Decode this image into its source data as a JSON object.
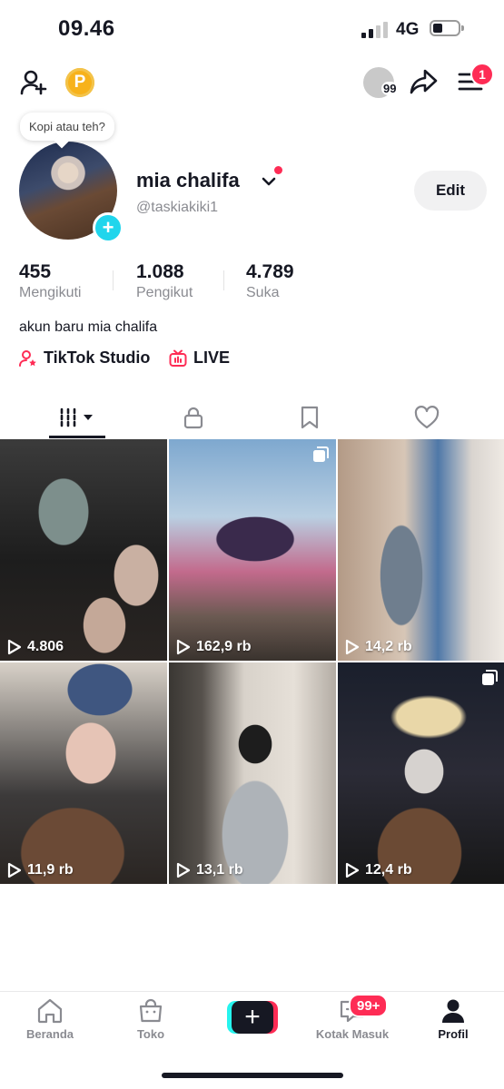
{
  "status_bar": {
    "time": "09.46",
    "network": "4G"
  },
  "top_bar": {
    "coin_label": "P",
    "viewer_count": "99",
    "menu_badge": "1"
  },
  "profile": {
    "bubble_note": "Kopi atau teh?",
    "name": "mia chalifa",
    "handle": "@taskiakiki1",
    "edit_label": "Edit",
    "stats": [
      {
        "value": "455",
        "label": "Mengikuti"
      },
      {
        "value": "1.088",
        "label": "Pengikut"
      },
      {
        "value": "4.789",
        "label": "Suka"
      }
    ],
    "bio": "akun baru mia chalifa",
    "quick_links": [
      {
        "label": "TikTok Studio",
        "icon": "person-star-icon"
      },
      {
        "label": "LIVE",
        "icon": "tv-icon"
      }
    ]
  },
  "tabs": [
    {
      "name": "videos",
      "icon": "grid-icon",
      "active": true
    },
    {
      "name": "private",
      "icon": "lock-icon",
      "active": false
    },
    {
      "name": "saved",
      "icon": "bookmark-icon",
      "active": false
    },
    {
      "name": "liked",
      "icon": "heart-icon",
      "active": false
    }
  ],
  "videos": [
    {
      "views": "4.806",
      "multi": false
    },
    {
      "views": "162,9 rb",
      "multi": true
    },
    {
      "views": "14,2 rb",
      "multi": false
    },
    {
      "views": "11,9 rb",
      "multi": false
    },
    {
      "views": "13,1 rb",
      "multi": false
    },
    {
      "views": "12,4 rb",
      "multi": true
    }
  ],
  "bottom_nav": {
    "items": [
      {
        "label": "Beranda",
        "icon": "home-icon"
      },
      {
        "label": "Toko",
        "icon": "shop-bag-icon"
      },
      {
        "label": "",
        "icon": "create-plus-icon"
      },
      {
        "label": "Kotak Masuk",
        "icon": "inbox-icon"
      },
      {
        "label": "Profil",
        "icon": "profile-icon",
        "active": true
      }
    ],
    "inbox_badge": "99+"
  },
  "colors": {
    "accent": "#fe2c55",
    "cyan": "#25f4ee",
    "text": "#161823",
    "muted": "#8a8b91"
  }
}
